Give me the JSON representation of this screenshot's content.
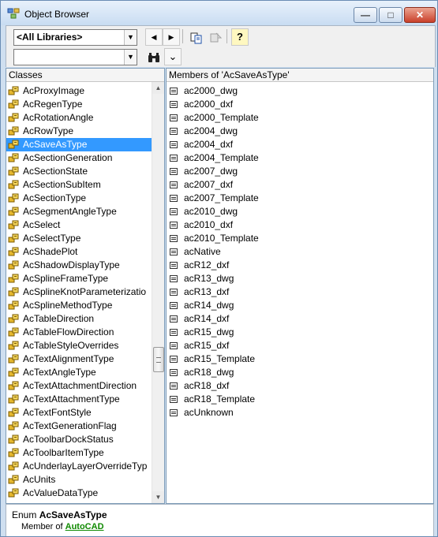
{
  "window": {
    "title": "Object Browser"
  },
  "toolbar": {
    "library_combo": "<All Libraries>",
    "search_combo": "",
    "back_label": "◀",
    "forward_label": "▶",
    "help_label": "?",
    "expand_label": "⌄"
  },
  "classes": {
    "header": "Classes",
    "items": [
      "AcProxyImage",
      "AcRegenType",
      "AcRotationAngle",
      "AcRowType",
      "AcSaveAsType",
      "AcSectionGeneration",
      "AcSectionState",
      "AcSectionSubItem",
      "AcSectionType",
      "AcSegmentAngleType",
      "AcSelect",
      "AcSelectType",
      "AcShadePlot",
      "AcShadowDisplayType",
      "AcSplineFrameType",
      "AcSplineKnotParameterizatio",
      "AcSplineMethodType",
      "AcTableDirection",
      "AcTableFlowDirection",
      "AcTableStyleOverrides",
      "AcTextAlignmentType",
      "AcTextAngleType",
      "AcTextAttachmentDirection",
      "AcTextAttachmentType",
      "AcTextFontStyle",
      "AcTextGenerationFlag",
      "AcToolbarDockStatus",
      "AcToolbarItemType",
      "AcUnderlayLayerOverrideTyp",
      "AcUnits",
      "AcValueDataType"
    ]
  },
  "members": {
    "header": "Members of 'AcSaveAsType'",
    "items": [
      "ac2000_dwg",
      "ac2000_dxf",
      "ac2000_Template",
      "ac2004_dwg",
      "ac2004_dxf",
      "ac2004_Template",
      "ac2007_dwg",
      "ac2007_dxf",
      "ac2007_Template",
      "ac2010_dwg",
      "ac2010_dxf",
      "ac2010_Template",
      "acNative",
      "acR12_dxf",
      "acR13_dwg",
      "acR13_dxf",
      "acR14_dwg",
      "acR14_dxf",
      "acR15_dwg",
      "acR15_dxf",
      "acR15_Template",
      "acR18_dwg",
      "acR18_dxf",
      "acR18_Template",
      "acUnknown"
    ]
  },
  "details": {
    "kind": "Enum",
    "name": "AcSaveAsType",
    "member_of": "Member of",
    "library": "AutoCAD"
  },
  "colors": {
    "selection": "#3399ff",
    "link": "#0f8a00"
  }
}
